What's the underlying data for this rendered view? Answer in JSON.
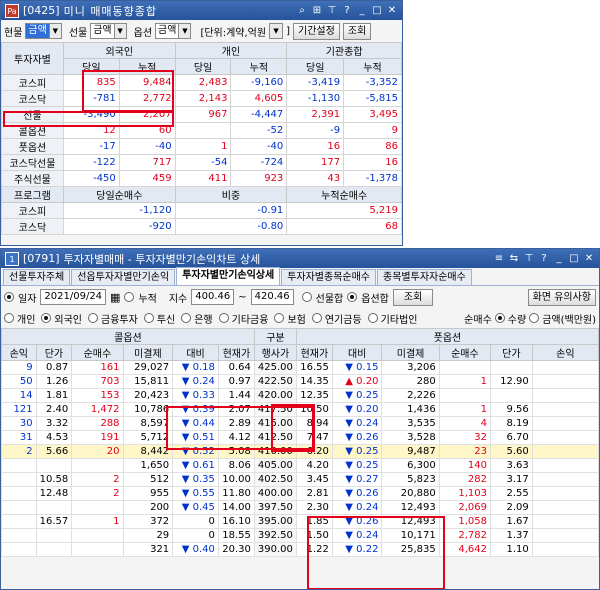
{
  "w1": {
    "id": "[0425]",
    "title": "미니 매매동향종합",
    "toolbar": {
      "l1": "현물",
      "v1": "금액",
      "l2": "선물",
      "v2": "금액",
      "l3": "옵션",
      "v3": "금액",
      "unit_label": "[단위:계약,억원",
      "unit_bracket": "]",
      "period_btn": "기간설정",
      "query_btn": "조회"
    },
    "header": {
      "investor": "투자자별",
      "g1": "외국인",
      "g2": "개인",
      "g3": "기관종합",
      "sub_day": "당일",
      "sub_cum": "누적"
    },
    "rows": [
      {
        "name": "코스피",
        "v": [
          "835",
          "9,484",
          "2,483",
          "-9,160",
          "-3,419",
          "-3,352"
        ]
      },
      {
        "name": "코스닥",
        "v": [
          "-781",
          "2,772",
          "2,143",
          "4,605",
          "-1,130",
          "-5,815"
        ]
      },
      {
        "name": "선물",
        "v": [
          "-3,490",
          "2,207",
          "967",
          "-4,447",
          "2,391",
          "3,495"
        ]
      },
      {
        "name": "콜옵션",
        "v": [
          "12",
          "60",
          "",
          "-52",
          "-9",
          "9"
        ]
      },
      {
        "name": "풋옵션",
        "v": [
          "-17",
          "-40",
          "1",
          "-40",
          "16",
          "86"
        ]
      },
      {
        "name": "코스닥선물",
        "v": [
          "-122",
          "717",
          "-54",
          "-724",
          "177",
          "16"
        ]
      },
      {
        "name": "주식선물",
        "v": [
          "-450",
          "459",
          "411",
          "923",
          "43",
          "-1,378"
        ]
      }
    ],
    "program": {
      "title": "프로그램",
      "h1": "당일순매수",
      "h2": "비중",
      "h3": "누적순매수",
      "rows": [
        {
          "name": "코스피",
          "v": [
            "-1,120",
            "-0.91",
            "5,219"
          ]
        },
        {
          "name": "코스닥",
          "v": [
            "-920",
            "-0.80",
            "68"
          ]
        }
      ]
    }
  },
  "w2": {
    "num": "1",
    "id": "[0791]",
    "title": "투자자별매매 - 투자자별만기손익차트 상세",
    "tabs": [
      "선물투자주체",
      "선옵투자자별만기손익",
      "투자자별만기손익상세",
      "투자자별종목순매수",
      "종목별투자자순매수"
    ],
    "row2": {
      "date_label": "일자",
      "date": "2021/09/24",
      "cum_label": "누적",
      "index_label": "지수",
      "from": "400.46",
      "tilde": "~",
      "to": "420.46",
      "opt1": "선물합",
      "opt2": "옵션합",
      "query": "조회",
      "help": "화면 유의사항"
    },
    "investors": [
      "개인",
      "외국인",
      "금융투자",
      "투신",
      "은행",
      "기타금융",
      "보험",
      "연기금등",
      "기타법인"
    ],
    "right": {
      "label": "순매수",
      "q": "수량",
      "a": "금액(백만원)"
    },
    "head": {
      "call": "콜옵션",
      "gubun": "구분",
      "put": "풋옵션",
      "c_cols": [
        "손익",
        "단가",
        "순매수",
        "미결제",
        "대비",
        "현재가"
      ],
      "strike": "행사가",
      "p_cols": [
        "현재가",
        "대비",
        "미결제",
        "순매수",
        "단가",
        "손익"
      ]
    },
    "rows": [
      {
        "c": [
          "9",
          "0.87",
          "161",
          "29,027",
          "▼ 0.18",
          "0.64"
        ],
        "k": "425.00",
        "p": [
          "16.55",
          "▼ 0.15",
          "3,206",
          "",
          "",
          ""
        ]
      },
      {
        "c": [
          "50",
          "1.26",
          "703",
          "15,811",
          "▼ 0.24",
          "0.97"
        ],
        "k": "422.50",
        "p": [
          "14.35",
          "▲ 0.20",
          "280",
          "1",
          "12.90",
          ""
        ]
      },
      {
        "c": [
          "14",
          "1.81",
          "153",
          "20,423",
          "▼ 0.33",
          "1.44"
        ],
        "k": "420.00",
        "p": [
          "12.35",
          "▼ 0.25",
          "2,226",
          "",
          "",
          ""
        ]
      },
      {
        "c": [
          "121",
          "2.40",
          "1,472",
          "10,786",
          "▼ 0.39",
          "2.07"
        ],
        "k": "417.50",
        "p": [
          "10.50",
          "▼ 0.20",
          "1,436",
          "1",
          "9.56",
          ""
        ]
      },
      {
        "c": [
          "30",
          "3.32",
          "288",
          "8,597",
          "▼ 0.44",
          "2.89"
        ],
        "k": "415.00",
        "p": [
          "8.94",
          "▼ 0.24",
          "3,535",
          "4",
          "8.19",
          ""
        ]
      },
      {
        "c": [
          "31",
          "4.53",
          "191",
          "5,712",
          "▼ 0.51",
          "4.12"
        ],
        "k": "412.50",
        "p": [
          "7.47",
          "▼ 0.26",
          "3,528",
          "32",
          "6.70",
          ""
        ]
      },
      {
        "c": [
          "2",
          "5.66",
          "20",
          "8,442",
          "▼ 0.52",
          "5.08"
        ],
        "k": "410.00",
        "p": [
          "6.20",
          "▼ 0.25",
          "9,487",
          "23",
          "5.60",
          ""
        ]
      },
      {
        "c": [
          "",
          "",
          "",
          "1,650",
          "▼ 0.61",
          "8.06"
        ],
        "k": "405.00",
        "p": [
          "4.20",
          "▼ 0.25",
          "6,300",
          "140",
          "3.63",
          ""
        ]
      },
      {
        "c": [
          "",
          "10.58",
          "2",
          "512",
          "▼ 0.35",
          "10.00"
        ],
        "k": "402.50",
        "p": [
          "3.45",
          "▼ 0.27",
          "5,823",
          "282",
          "3.17",
          ""
        ]
      },
      {
        "c": [
          "",
          "12.48",
          "2",
          "955",
          "▼ 0.55",
          "11.80"
        ],
        "k": "400.00",
        "p": [
          "2.81",
          "▼ 0.26",
          "20,880",
          "1,103",
          "2.55",
          ""
        ]
      },
      {
        "c": [
          "",
          "",
          "",
          "200",
          "▼ 0.45",
          "14.00"
        ],
        "k": "397.50",
        "p": [
          "2.30",
          "▼ 0.24",
          "12,493",
          "2,069",
          "2.09",
          ""
        ]
      },
      {
        "c": [
          "",
          "16.57",
          "1",
          "372",
          "0",
          "16.10"
        ],
        "k": "395.00",
        "p": [
          "1.85",
          "▼ 0.26",
          "12,493",
          "1,058",
          "1.67",
          ""
        ]
      },
      {
        "c": [
          "",
          "",
          "",
          "29",
          "0",
          "18.55"
        ],
        "k": "392.50",
        "p": [
          "1.50",
          "▼ 0.24",
          "10,171",
          "2,782",
          "1.37",
          ""
        ]
      },
      {
        "c": [
          "",
          "",
          "",
          "321",
          "▼ 0.40",
          "20.30"
        ],
        "k": "390.00",
        "p": [
          "1.22",
          "▼ 0.22",
          "25,835",
          "4,642",
          "1.10",
          ""
        ]
      }
    ]
  }
}
